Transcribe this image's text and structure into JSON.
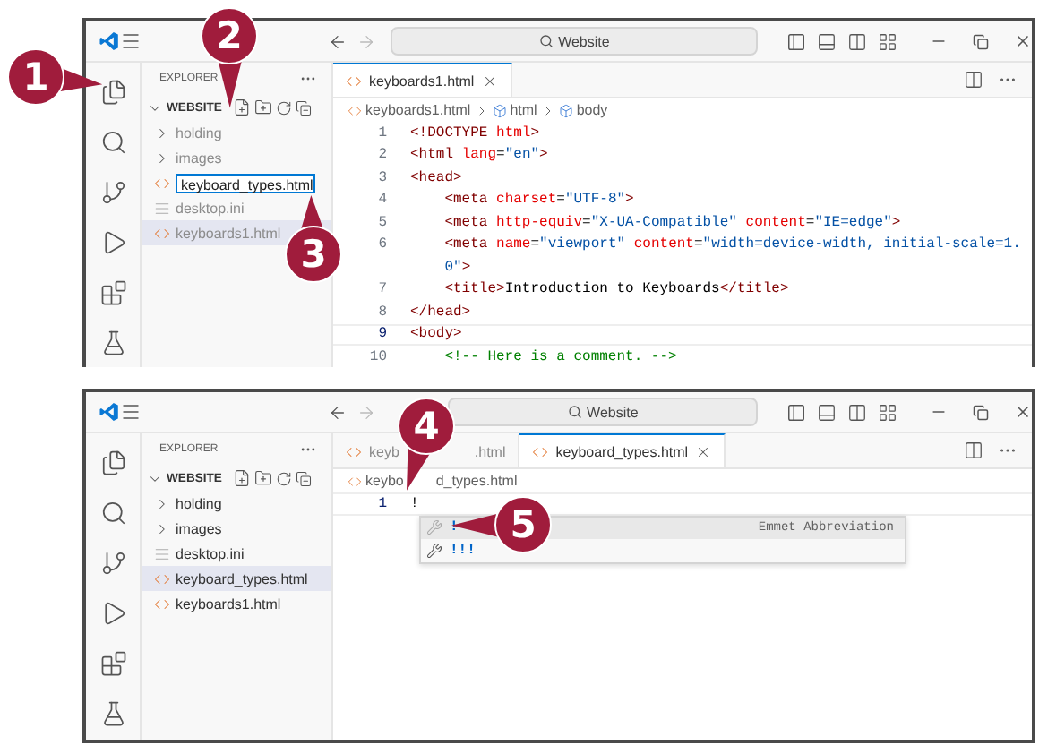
{
  "windows": [
    {
      "title_bar": {
        "search": "Website"
      },
      "sidebar": {
        "title": "EXPLORER",
        "section": "WEBSITE",
        "items": [
          {
            "kind": "folder",
            "name": "holding",
            "dimmed": true,
            "selected": false,
            "editing": false
          },
          {
            "kind": "folder",
            "name": "images",
            "dimmed": true,
            "selected": false,
            "editing": false
          },
          {
            "kind": "html",
            "name": "keyboard_types.html",
            "dimmed": false,
            "selected": false,
            "editing": true
          },
          {
            "kind": "ini",
            "name": "desktop.ini",
            "dimmed": true,
            "selected": false,
            "editing": false
          },
          {
            "kind": "html",
            "name": "keyboards1.html",
            "dimmed": true,
            "selected": true,
            "editing": false
          }
        ]
      },
      "editor": {
        "tabs": [
          {
            "label": "keyboards1.html",
            "selected": true,
            "closable": true
          }
        ],
        "breadcrumbs": [
          {
            "kind": "file",
            "label": "keyboards1.html"
          },
          {
            "kind": "symbol",
            "label": "html"
          },
          {
            "kind": "symbol",
            "label": "body"
          }
        ],
        "lines": [
          {
            "number": "1",
            "current": false,
            "tokens": [
              {
                "kind": "tag",
                "text": "<!DOCTYPE"
              },
              {
                "kind": "attr",
                "text": " html"
              },
              {
                "kind": "tag",
                "text": ">"
              }
            ]
          },
          {
            "number": "2",
            "current": false,
            "tokens": [
              {
                "kind": "tag",
                "text": "<html"
              },
              {
                "kind": "attr",
                "text": " lang"
              },
              {
                "kind": "text",
                "text": "="
              },
              {
                "kind": "string",
                "text": "\"en\""
              },
              {
                "kind": "tag",
                "text": ">"
              }
            ]
          },
          {
            "number": "3",
            "current": false,
            "tokens": [
              {
                "kind": "tag",
                "text": "<head>"
              }
            ]
          },
          {
            "number": "4",
            "current": false,
            "tokens": [
              {
                "kind": "tag",
                "text": "    <meta"
              },
              {
                "kind": "attr",
                "text": " charset"
              },
              {
                "kind": "text",
                "text": "="
              },
              {
                "kind": "string",
                "text": "\"UTF-8\""
              },
              {
                "kind": "tag",
                "text": ">"
              }
            ]
          },
          {
            "number": "5",
            "current": false,
            "tokens": [
              {
                "kind": "tag",
                "text": "    <meta"
              },
              {
                "kind": "attr",
                "text": " http-equiv"
              },
              {
                "kind": "text",
                "text": "="
              },
              {
                "kind": "string",
                "text": "\"X-UA-Compatible\""
              },
              {
                "kind": "attr",
                "text": " content"
              },
              {
                "kind": "text",
                "text": "="
              },
              {
                "kind": "string",
                "text": "\"IE=edge\""
              },
              {
                "kind": "tag",
                "text": ">"
              }
            ]
          },
          {
            "number": "6",
            "current": false,
            "tokens": [
              {
                "kind": "tag",
                "text": "    <meta"
              },
              {
                "kind": "attr",
                "text": " name"
              },
              {
                "kind": "text",
                "text": "="
              },
              {
                "kind": "string",
                "text": "\"viewport\""
              },
              {
                "kind": "attr",
                "text": " content"
              },
              {
                "kind": "text",
                "text": "="
              },
              {
                "kind": "string",
                "text": "\"width=device-width, initial-scale=1."
              }
            ]
          },
          {
            "current": false,
            "tokens": [
              {
                "kind": "string",
                "text": "    0\""
              },
              {
                "kind": "tag",
                "text": ">"
              }
            ]
          },
          {
            "number": "7",
            "current": false,
            "tokens": [
              {
                "kind": "tag",
                "text": "    <title>"
              },
              {
                "kind": "text",
                "text": "Introduction to Keyboards"
              },
              {
                "kind": "tag",
                "text": "</title>"
              }
            ]
          },
          {
            "number": "8",
            "current": false,
            "tokens": [
              {
                "kind": "tag",
                "text": "</head>"
              }
            ]
          },
          {
            "number": "9",
            "current": true,
            "tokens": [
              {
                "kind": "tag",
                "text": "<body>"
              }
            ]
          },
          {
            "number": "10",
            "current": false,
            "tokens": [
              {
                "kind": "comment",
                "text": "    <!-- Here is a comment. -->"
              }
            ]
          }
        ]
      }
    },
    {
      "title_bar": {
        "search": "Website"
      },
      "sidebar": {
        "title": "EXPLORER",
        "section": "WEBSITE",
        "items": [
          {
            "kind": "folder",
            "name": "holding",
            "dimmed": false,
            "selected": false,
            "editing": false
          },
          {
            "kind": "folder",
            "name": "images",
            "dimmed": false,
            "selected": false,
            "editing": false
          },
          {
            "kind": "ini",
            "name": "desktop.ini",
            "dimmed": false,
            "selected": false,
            "editing": false
          },
          {
            "kind": "html",
            "name": "keyboard_types.html",
            "dimmed": false,
            "selected": true,
            "editing": false
          },
          {
            "kind": "html",
            "name": "keyboards1.html",
            "dimmed": false,
            "selected": false,
            "editing": false
          }
        ]
      },
      "editor": {
        "tabs": [
          {
            "label_parts": [
              "keyb",
              ".html"
            ],
            "selected": false,
            "closable": false
          },
          {
            "label": "keyboard_types.html",
            "selected": true,
            "closable": true
          }
        ],
        "breadcrumbs": [
          {
            "kind": "file",
            "label_parts": [
              "keybo",
              "d_types.html"
            ]
          }
        ],
        "lines": [
          {
            "number": "1",
            "current": true,
            "tokens": [
              {
                "kind": "text",
                "text": "!"
              }
            ]
          }
        ],
        "suggestions": [
          {
            "label": "!",
            "detail": "Emmet Abbreviation",
            "selected": true
          },
          {
            "label": "!!!",
            "selected": false
          }
        ]
      }
    }
  ],
  "callouts": [
    "1",
    "2",
    "3",
    "4",
    "5"
  ]
}
